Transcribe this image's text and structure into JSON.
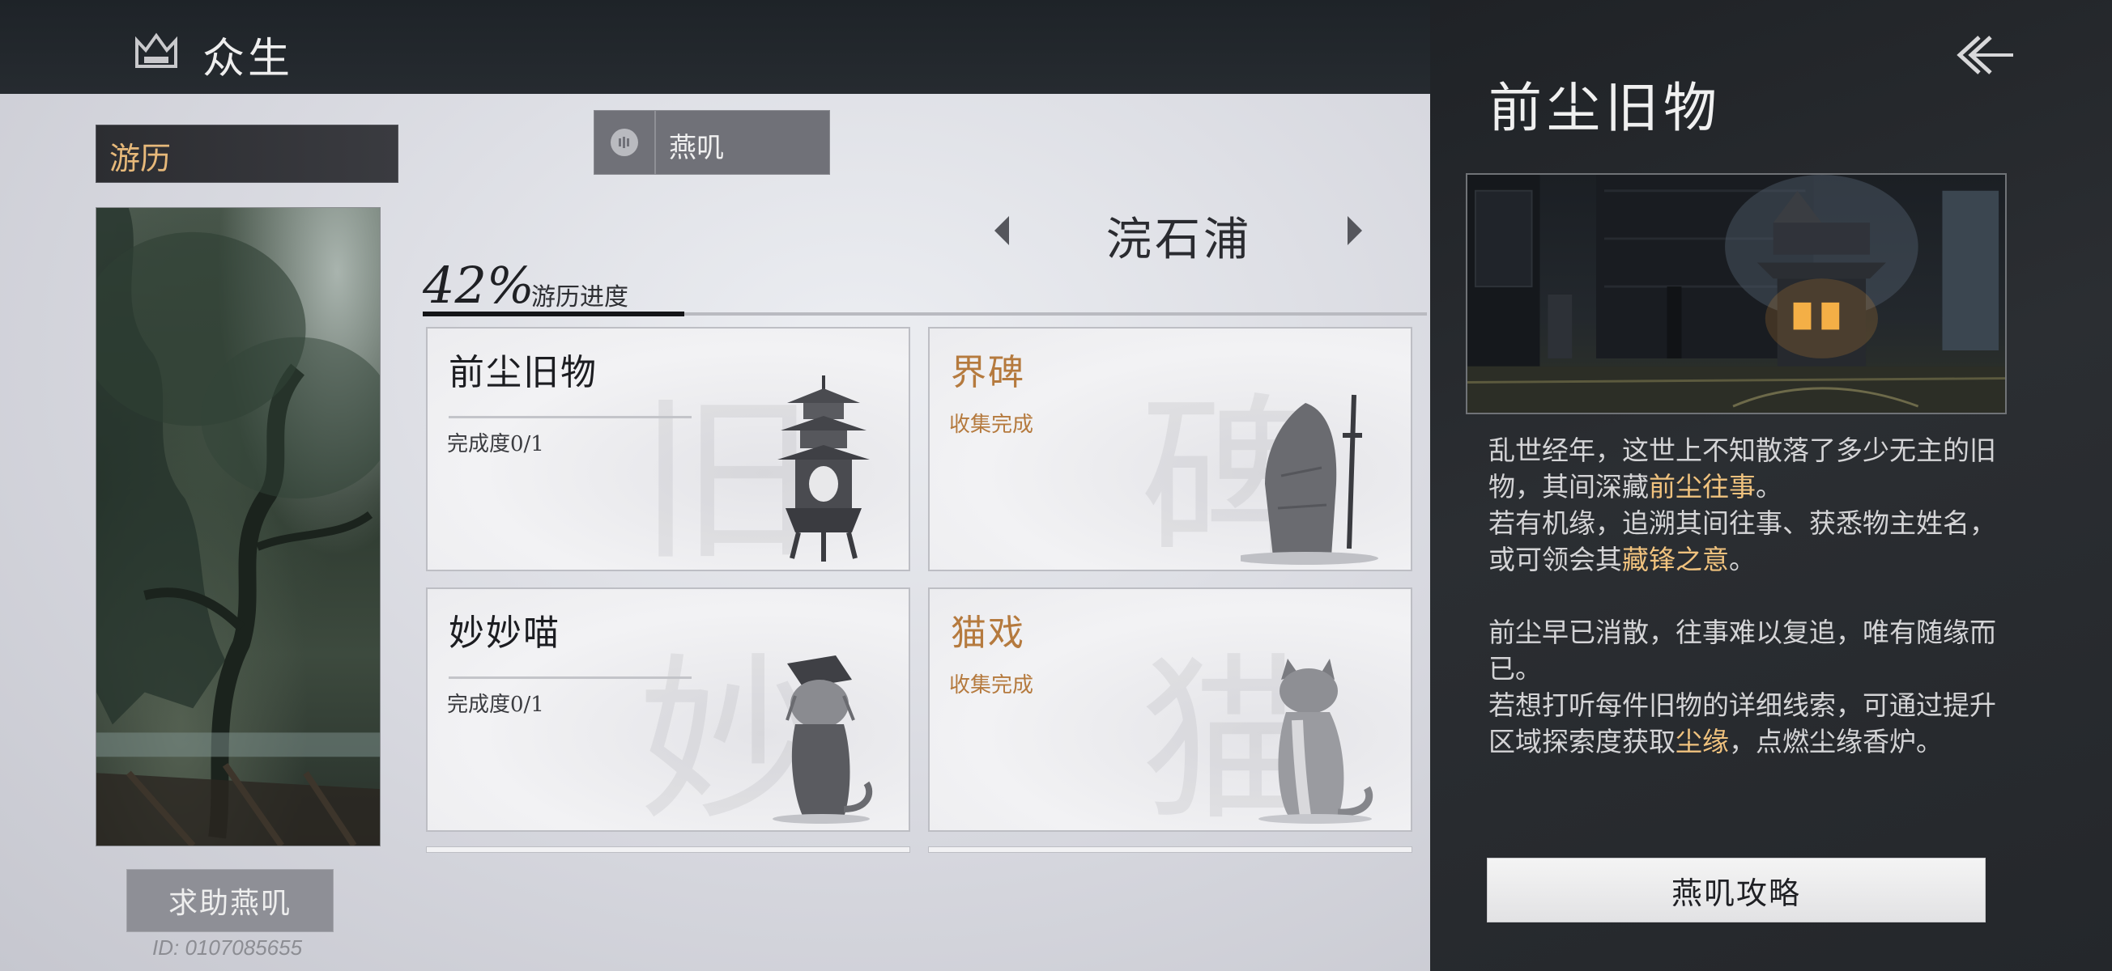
{
  "header": {
    "title": "众生",
    "icon": "crown-icon"
  },
  "sidebar": {
    "tab_label": "游历",
    "help_button": "求助燕叽",
    "player_id": "ID: 0107085655"
  },
  "filter": {
    "label": "燕叽",
    "icon": "voice-icon"
  },
  "region": {
    "name": "浣石浦"
  },
  "progress": {
    "percent_text": "42%",
    "label": "游历进度",
    "value": 0.42
  },
  "cards": [
    {
      "title": "前尘旧物",
      "status": "完成度0/1",
      "complete": false,
      "icon": "pagoda-incense-burner-icon"
    },
    {
      "title": "界碑",
      "status": "收集完成",
      "complete": true,
      "icon": "stone-tablet-sword-icon"
    },
    {
      "title": "妙妙喵",
      "status": "完成度0/1",
      "complete": false,
      "icon": "cat-in-hat-icon"
    },
    {
      "title": "猫戏",
      "status": "收集完成",
      "complete": true,
      "icon": "sitting-cat-icon"
    }
  ],
  "detail_panel": {
    "title": "前尘旧物",
    "paragraph1": [
      {
        "text": "乱世经年，这世上不知散落了多少无主的旧物，其间深藏",
        "hl": false
      },
      {
        "text": "前尘往事",
        "hl": true
      },
      {
        "text": "。",
        "hl": false
      }
    ],
    "paragraph2": [
      {
        "text": "若有机缘，追溯其间往事、获悉物主姓名，或可领会其",
        "hl": false
      },
      {
        "text": "藏锋之意",
        "hl": true
      },
      {
        "text": "。",
        "hl": false
      }
    ],
    "paragraph3": [
      {
        "text": "前尘早已消散，往事难以复追，唯有随缘而已。",
        "hl": false
      }
    ],
    "paragraph4": [
      {
        "text": "若想打听每件旧物的详细线索，可通过提升区域探索度获取",
        "hl": false
      },
      {
        "text": "尘缘",
        "hl": true
      },
      {
        "text": "，点燃尘缘香炉。",
        "hl": false
      }
    ],
    "guide_button": "燕叽攻略"
  },
  "colors": {
    "accent_gold": "#b57a3e",
    "highlight": "#f0c27e",
    "panel_bg": "#24272b"
  }
}
